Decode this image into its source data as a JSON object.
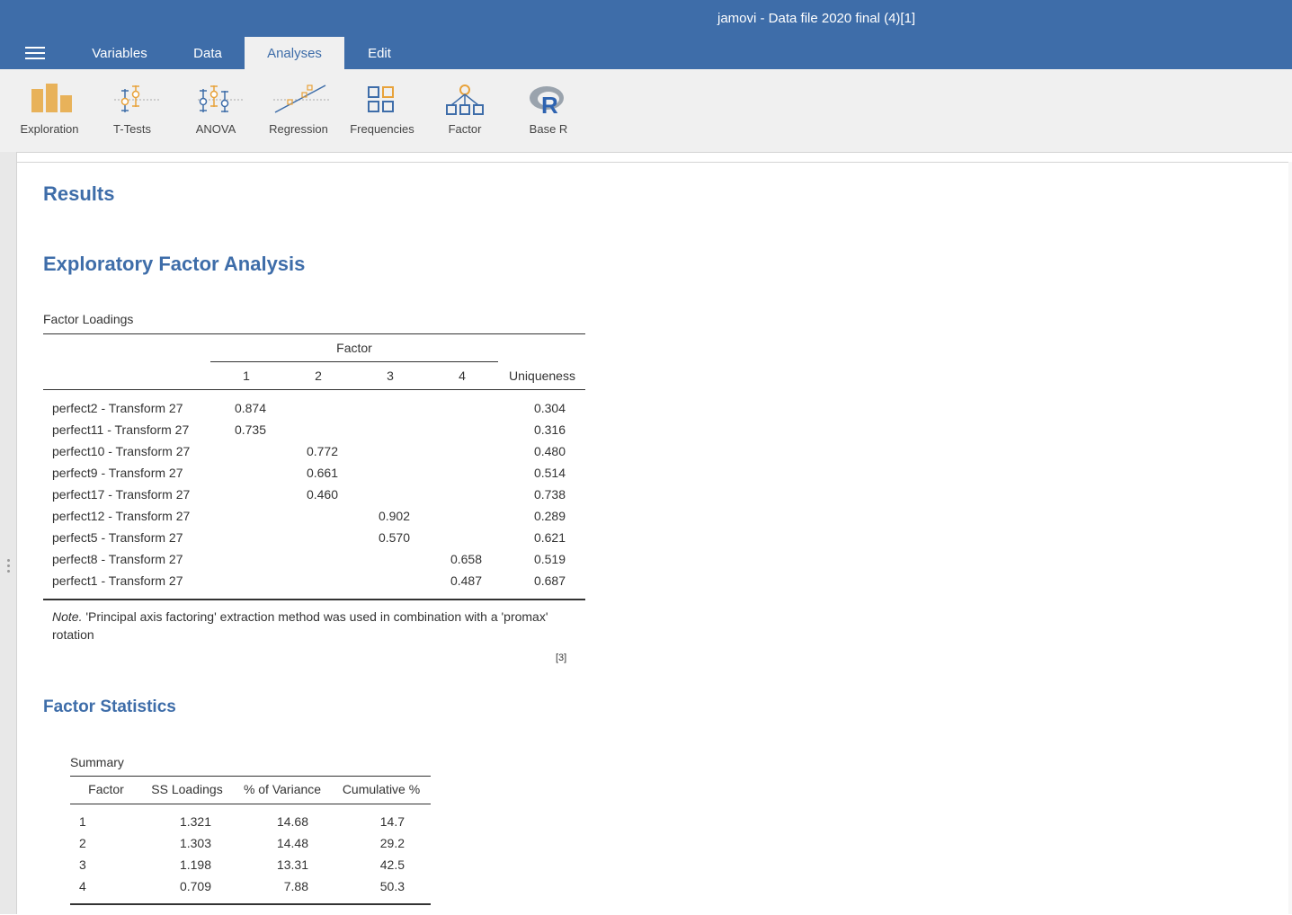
{
  "app": {
    "title": "jamovi - Data file 2020 final (4)[1]"
  },
  "tabs": [
    {
      "label": "Variables",
      "active": false
    },
    {
      "label": "Data",
      "active": false
    },
    {
      "label": "Analyses",
      "active": true
    },
    {
      "label": "Edit",
      "active": false
    }
  ],
  "ribbon": {
    "buttons": [
      {
        "label": "Exploration",
        "icon": "exploration-icon"
      },
      {
        "label": "T-Tests",
        "icon": "t-tests-icon"
      },
      {
        "label": "ANOVA",
        "icon": "anova-icon"
      },
      {
        "label": "Regression",
        "icon": "regression-icon"
      },
      {
        "label": "Frequencies",
        "icon": "frequencies-icon"
      },
      {
        "label": "Factor",
        "icon": "factor-icon"
      },
      {
        "label": "Base R",
        "icon": "base-r-icon"
      }
    ]
  },
  "colors": {
    "brand": "#3e6da9",
    "ribbon": "#f0f0f0",
    "icon_orange": "#e8a23a",
    "icon_blue": "#3e6da9"
  },
  "results": {
    "heading": "Results",
    "efa_heading": "Exploratory Factor Analysis",
    "loadings": {
      "caption": "Factor Loadings",
      "group_header": "Factor",
      "columns": [
        "1",
        "2",
        "3",
        "4",
        "Uniqueness"
      ],
      "rows": [
        {
          "name": "perfect2 - Transform 27",
          "f1": "0.874",
          "f2": "",
          "f3": "",
          "f4": "",
          "uniq": "0.304"
        },
        {
          "name": "perfect11 - Transform 27",
          "f1": "0.735",
          "f2": "",
          "f3": "",
          "f4": "",
          "uniq": "0.316"
        },
        {
          "name": "perfect10 - Transform 27",
          "f1": "",
          "f2": "0.772",
          "f3": "",
          "f4": "",
          "uniq": "0.480"
        },
        {
          "name": "perfect9 - Transform 27",
          "f1": "",
          "f2": "0.661",
          "f3": "",
          "f4": "",
          "uniq": "0.514"
        },
        {
          "name": "perfect17 - Transform 27",
          "f1": "",
          "f2": "0.460",
          "f3": "",
          "f4": "",
          "uniq": "0.738"
        },
        {
          "name": "perfect12 - Transform 27",
          "f1": "",
          "f2": "",
          "f3": "0.902",
          "f4": "",
          "uniq": "0.289"
        },
        {
          "name": "perfect5 - Transform 27",
          "f1": "",
          "f2": "",
          "f3": "0.570",
          "f4": "",
          "uniq": "0.621"
        },
        {
          "name": "perfect8 - Transform 27",
          "f1": "",
          "f2": "",
          "f3": "",
          "f4": "0.658",
          "uniq": "0.519"
        },
        {
          "name": "perfect1 - Transform 27",
          "f1": "",
          "f2": "",
          "f3": "",
          "f4": "0.487",
          "uniq": "0.687"
        }
      ],
      "note_label": "Note.",
      "note_text": " 'Principal axis factoring' extraction method was used in combination with a 'promax' rotation",
      "ref": "[3]"
    },
    "factor_statistics": {
      "heading": "Factor Statistics",
      "caption": "Summary",
      "columns": [
        "Factor",
        "SS Loadings",
        "% of Variance",
        "Cumulative %"
      ],
      "rows": [
        {
          "factor": "1",
          "ss": "1.321",
          "pct": "14.68",
          "cum": "14.7"
        },
        {
          "factor": "2",
          "ss": "1.303",
          "pct": "14.48",
          "cum": "29.2"
        },
        {
          "factor": "3",
          "ss": "1.198",
          "pct": "13.31",
          "cum": "42.5"
        },
        {
          "factor": "4",
          "ss": "0.709",
          "pct": "7.88",
          "cum": "50.3"
        }
      ]
    }
  }
}
